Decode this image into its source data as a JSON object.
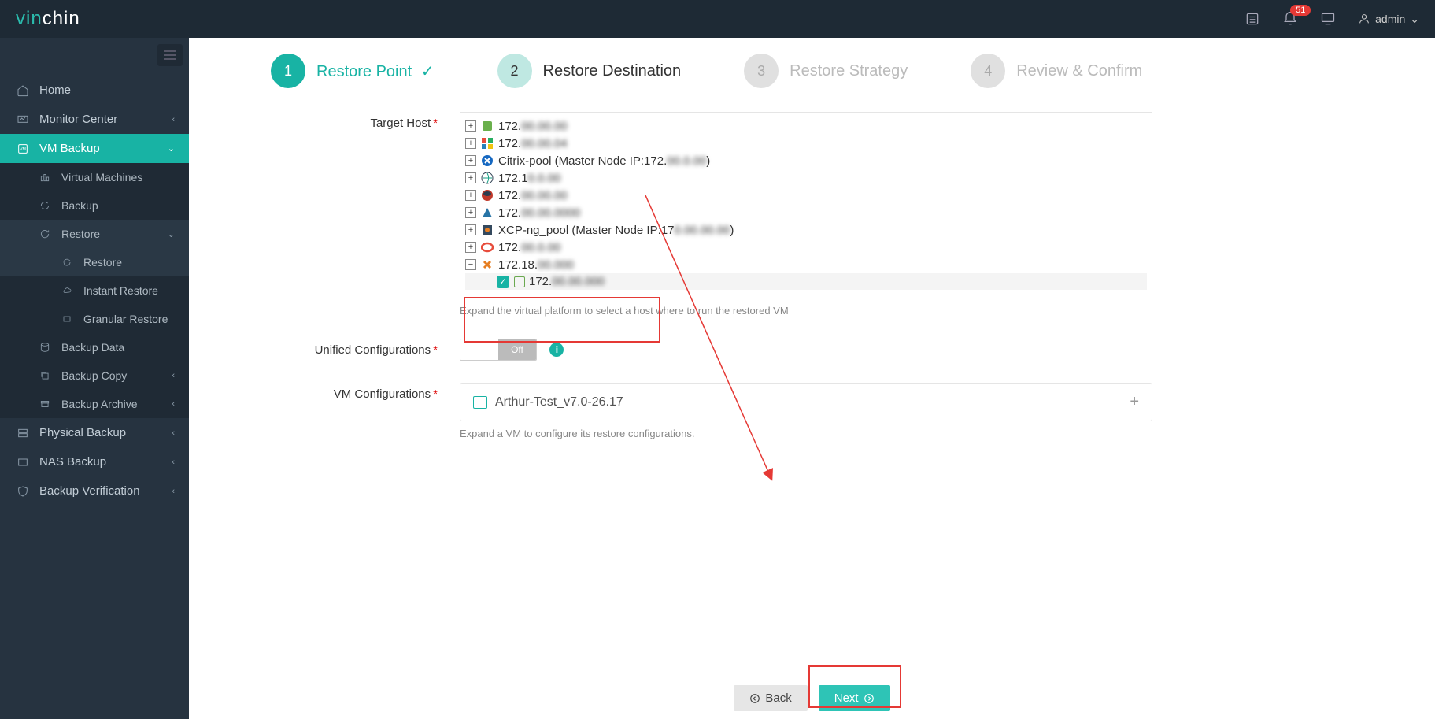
{
  "brand": {
    "part1": "vin",
    "part2": "chin"
  },
  "topbar": {
    "badge": "51",
    "user": "admin"
  },
  "sidebar": {
    "home": "Home",
    "monitor": "Monitor Center",
    "vmbackup": "VM Backup",
    "virtual_machines": "Virtual Machines",
    "backup": "Backup",
    "restore": "Restore",
    "restore2": "Restore",
    "instant_restore": "Instant Restore",
    "granular_restore": "Granular Restore",
    "backup_data": "Backup Data",
    "backup_copy": "Backup Copy",
    "backup_archive": "Backup Archive",
    "physical_backup": "Physical Backup",
    "nas_backup": "NAS Backup",
    "backup_verification": "Backup Verification"
  },
  "wizard": {
    "s1_num": "1",
    "s1_label": "Restore Point",
    "s2_num": "2",
    "s2_label": "Restore Destination",
    "s3_num": "3",
    "s3_label": "Restore Strategy",
    "s4_num": "4",
    "s4_label": "Review & Confirm"
  },
  "form": {
    "target_host_label": "Target Host",
    "target_host_helper": "Expand the virtual platform to select a host where to run the restored VM",
    "unified_label": "Unified Configurations",
    "toggle_off": "Off",
    "vmconf_label": "VM Configurations",
    "vmconf_value": "Arthur-Test_v7.0-26.17",
    "vmconf_helper": "Expand a VM to configure its restore configurations."
  },
  "tree": {
    "n0": "172.",
    "n1": "172.",
    "n2": "Citrix-pool (Master Node IP:172.",
    "n2b": ")",
    "n3": "172.1",
    "n4": "172.",
    "n5": "172.",
    "n6": "XCP-ng_pool (Master Node IP:17",
    "n6b": ")",
    "n7": "172.",
    "n8": "172.18.",
    "n8_child": "172."
  },
  "footer": {
    "back": "Back",
    "next": "Next"
  }
}
